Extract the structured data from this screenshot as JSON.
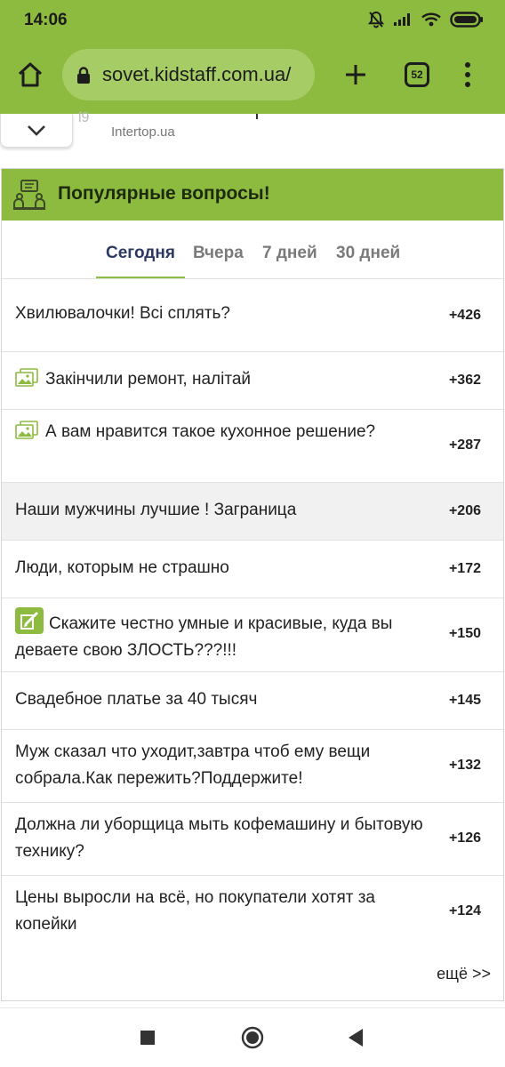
{
  "status_bar": {
    "time": "14:06",
    "battery_icon": "battery-icon",
    "wifi_icon": "wifi-icon",
    "signal_icon": "signal-icon",
    "mute_icon": "bell-off-icon"
  },
  "browser": {
    "url": "sovet.kidstaff.com.ua/",
    "tab_count": "52",
    "accent": "#8dbb40"
  },
  "ad": {
    "source": "Intertop.ua"
  },
  "widget": {
    "title": "Популярные вопросы!",
    "tabs": [
      {
        "label": "Сегодня",
        "active": true
      },
      {
        "label": "Вчера",
        "active": false
      },
      {
        "label": "7 дней",
        "active": false
      },
      {
        "label": "30 дней",
        "active": false
      }
    ],
    "items": [
      {
        "title": "Хвилювалочки! Всі сплять?",
        "score": "+426",
        "icon": null
      },
      {
        "title": "Закінчили ремонт, налітай",
        "score": "+362",
        "icon": "photo-icon"
      },
      {
        "title": "А вам нравится такое кухонное решение?",
        "score": "+287",
        "icon": "photo-icon"
      },
      {
        "title": "Наши мужчины лучшие ! Заграница",
        "score": "+206",
        "icon": null
      },
      {
        "title": "Люди, которым не страшно",
        "score": "+172",
        "icon": null
      },
      {
        "title": "Скажите честно умные и красивые, куда вы деваете свою ЗЛОСТЬ???!!!",
        "score": "+150",
        "icon": "poll-icon"
      },
      {
        "title": "Свадебное платье за 40 тысяч",
        "score": "+145",
        "icon": null
      },
      {
        "title": "Муж сказал что уходит,завтра чтоб ему вещи собрала.Как пережить?Поддержите!",
        "score": "+132",
        "icon": null
      },
      {
        "title": "Должна ли уборщица мыть кофемашину и бытовую технику?",
        "score": "+126",
        "icon": null
      },
      {
        "title": "Цены выросли на всё, но покупатели хотят за копейки",
        "score": "+124",
        "icon": null
      }
    ],
    "more": "ещё >>"
  }
}
